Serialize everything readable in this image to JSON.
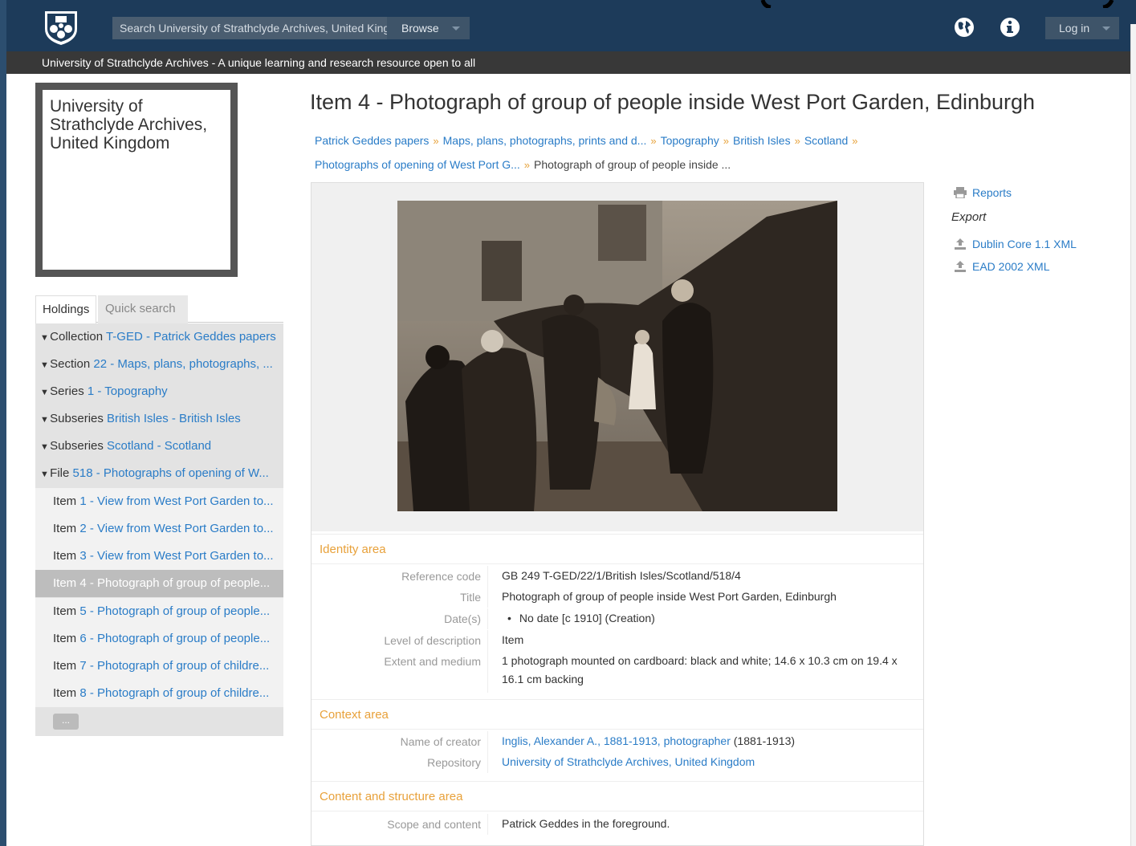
{
  "header": {
    "search_placeholder": "Search University of Strathclyde Archives, United Kingdom",
    "browse_label": "Browse",
    "login_label": "Log in",
    "tagline": "University of Strathclyde Archives - A unique learning and research resource open to all"
  },
  "repository": {
    "name_line1": "University of",
    "name_line2": "Strathclyde Archives,",
    "name_line3": "United Kingdom"
  },
  "tabs": {
    "holdings": "Holdings",
    "quick_search": "Quick search"
  },
  "tree": {
    "parents": [
      {
        "level": "Collection",
        "link": "T-GED - Patrick Geddes papers"
      },
      {
        "level": "Section",
        "link": "22 - Maps, plans, photographs, ..."
      },
      {
        "level": "Series",
        "link": "1 - Topography"
      },
      {
        "level": "Subseries",
        "link": "British Isles - British Isles"
      },
      {
        "level": "Subseries",
        "link": "Scotland - Scotland"
      },
      {
        "level": "File",
        "link": "518 - Photographs of opening of W..."
      }
    ],
    "items": [
      {
        "level": "Item",
        "link": "1 - View from West Port Garden to..."
      },
      {
        "level": "Item",
        "link": "2 - View from West Port Garden to..."
      },
      {
        "level": "Item",
        "link": "3 - View from West Port Garden to..."
      },
      {
        "level": "Item",
        "link": "4 - Photograph of group of people..."
      },
      {
        "level": "Item",
        "link": "5 - Photograph of group of people..."
      },
      {
        "level": "Item",
        "link": "6 - Photograph of group of people..."
      },
      {
        "level": "Item",
        "link": "7 - Photograph of group of childre..."
      },
      {
        "level": "Item",
        "link": "8 - Photograph of group of childre..."
      }
    ],
    "more_label": "..."
  },
  "main": {
    "title": "Item 4 - Photograph of group of people inside West Port Garden, Edinburgh",
    "breadcrumbs": [
      "Patrick Geddes papers",
      "Maps, plans, photographs, prints and d...",
      "Topography",
      "British Isles",
      "Scotland",
      "Photographs of opening of West Port G...",
      "Photograph of group of people inside ..."
    ],
    "identity": {
      "heading": "Identity area",
      "reference_code_label": "Reference code",
      "reference_code": "GB 249 T-GED/22/1/British Isles/Scotland/518/4",
      "title_label": "Title",
      "title": "Photograph of group of people inside West Port Garden, Edinburgh",
      "dates_label": "Date(s)",
      "dates": "No date [c 1910] (Creation)",
      "level_label": "Level of description",
      "level": "Item",
      "extent_label": "Extent and medium",
      "extent": "1 photograph mounted on cardboard: black and white; 14.6 x 10.3 cm on 19.4 x 16.1 cm backing"
    },
    "context": {
      "heading": "Context area",
      "creator_label": "Name of creator",
      "creator_link": "Inglis, Alexander A., 1881-1913, photographer",
      "creator_dates": " (1881-1913)",
      "repository_label": "Repository",
      "repository": "University of Strathclyde Archives, United Kingdom"
    },
    "content": {
      "heading": "Content and structure area",
      "scope_label": "Scope and content",
      "scope": "Patrick Geddes in the foreground."
    }
  },
  "sidebar_right": {
    "reports": "Reports",
    "export_label": "Export",
    "dublin_core": "Dublin Core 1.1 XML",
    "ead": "EAD 2002 XML"
  },
  "colors": {
    "header_bg": "#1d3b5a",
    "link": "#2a7cc7",
    "section_heading": "#e8a13a",
    "tagline_bg": "#383838"
  }
}
